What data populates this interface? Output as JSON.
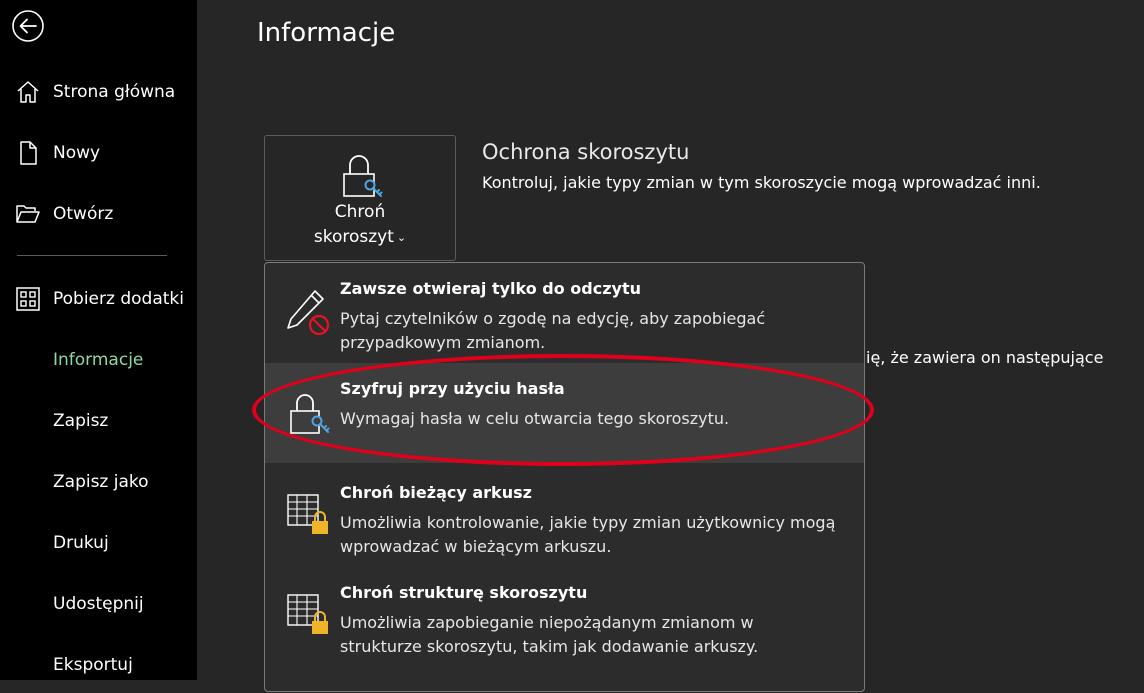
{
  "sidebar": {
    "items": [
      {
        "label": "Strona główna",
        "icon": "home-icon"
      },
      {
        "label": "Nowy",
        "icon": "new-document-icon"
      },
      {
        "label": "Otwórz",
        "icon": "folder-open-icon"
      },
      {
        "label": "Pobierz dodatki",
        "icon": "addins-grid-icon"
      },
      {
        "label": "Informacje",
        "active": true
      },
      {
        "label": "Zapisz"
      },
      {
        "label": "Zapisz jako"
      },
      {
        "label": "Drukuj"
      },
      {
        "label": "Udostępnij"
      },
      {
        "label": "Eksportuj"
      }
    ]
  },
  "page": {
    "title": "Informacje"
  },
  "protect_button": {
    "line1": "Chroń",
    "line2": "skoroszyt",
    "icon": "lock-key-icon"
  },
  "section": {
    "title": "Ochrona skoroszytu",
    "description": "Kontroluj, jakie typy zmian w tym skoroszycie mogą wprowadzać inni."
  },
  "background_text": "ię, że zawiera on następujące",
  "menu": {
    "items": [
      {
        "title": "Zawsze otwieraj tylko do odczytu",
        "description": "Pytaj czytelników o zgodę na edycję, aby zapobiegać przypadkowym zmianom.",
        "icon": "pencil-no-edit-icon"
      },
      {
        "title": "Szyfruj przy użyciu hasła",
        "description": "Wymagaj hasła w celu otwarcia tego skoroszytu.",
        "icon": "lock-key-icon",
        "highlighted": true
      },
      {
        "title": "Chroń bieżący arkusz",
        "description": "Umożliwia kontrolowanie, jakie typy zmian użytkownicy mogą wprowadzać w bieżącym arkuszu.",
        "icon": "sheet-lock-icon"
      },
      {
        "title": "Chroń strukturę skoroszytu",
        "description": "Umożliwia zapobieganie niepożądanym zmianom w strukturze skoroszytu, takim jak dodawanie arkuszy.",
        "icon": "sheet-lock-icon"
      }
    ]
  },
  "colors": {
    "sidebar_bg": "#000000",
    "main_bg": "#262626",
    "menu_bg": "#2c2c2c",
    "active_nav": "#8ed9a1",
    "annotation_red": "#e0001b",
    "key_blue": "#4fa3e0",
    "lock_gold": "#f0b429"
  }
}
